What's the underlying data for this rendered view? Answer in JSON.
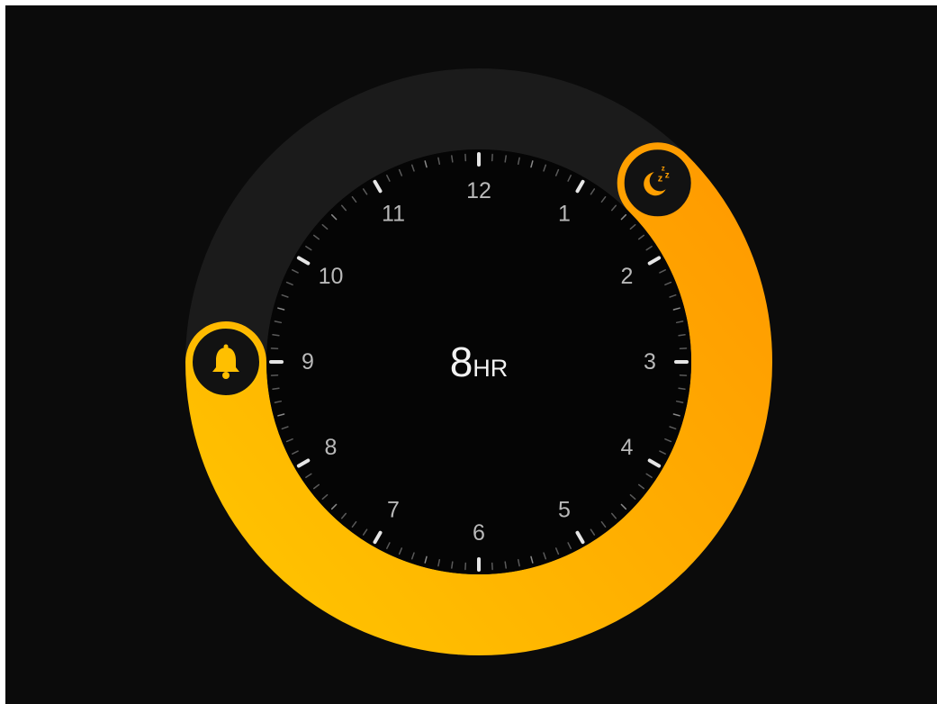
{
  "sleep_dial": {
    "duration_value": "8",
    "duration_unit": "HR",
    "bedtime_hour": 1.5,
    "wake_hour": 9.0,
    "hour_labels": [
      "12",
      "1",
      "2",
      "3",
      "4",
      "5",
      "6",
      "7",
      "8",
      "9",
      "10",
      "11"
    ],
    "bedtime_icon": "moon-zzz-icon",
    "wake_icon": "bell-icon"
  },
  "colors": {
    "background": "#0b0b0b",
    "track": "#1b1b1b",
    "face": "#050505",
    "accent_light": "#ffc300",
    "accent_dark": "#ff9a00",
    "tick_major": "#e6e6e6",
    "tick_minor": "#5a5a5a"
  }
}
